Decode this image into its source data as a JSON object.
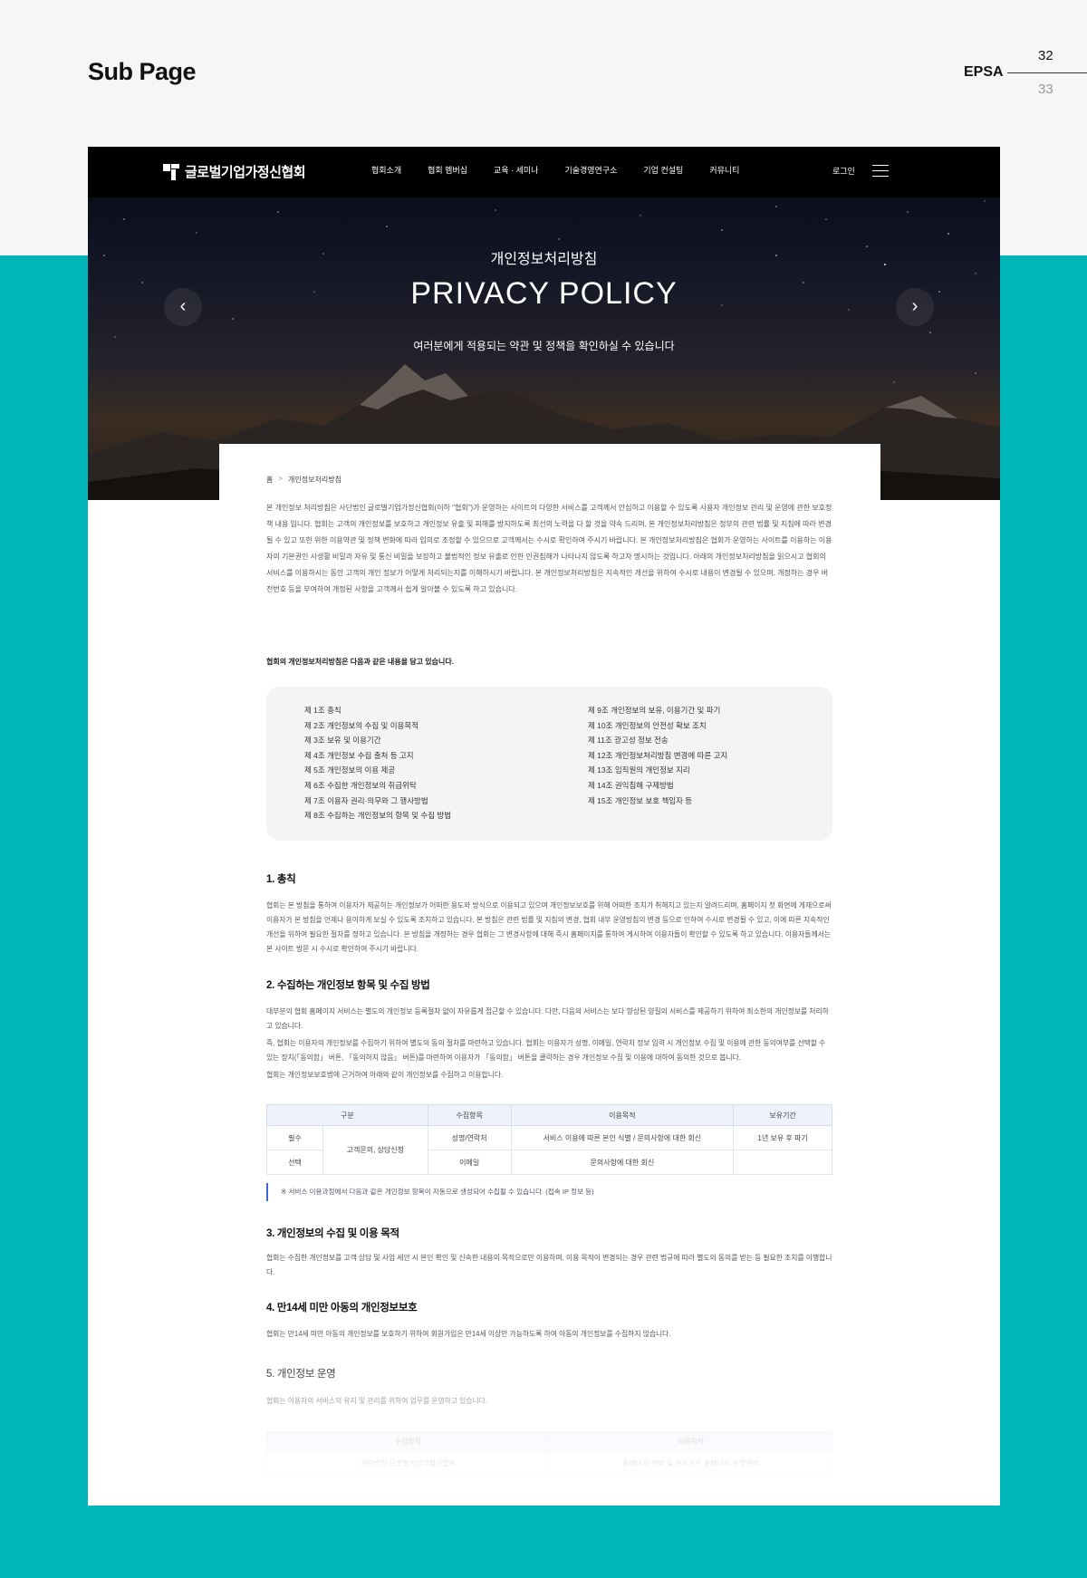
{
  "presentation": {
    "title": "Sub Page",
    "brand": "EPSA",
    "page_current": "32",
    "page_next": "33",
    "colors": {
      "band": "#00b5b8",
      "background": "#f6f6f6",
      "accent": "#3a64d8"
    }
  },
  "header": {
    "logo_text": "글로벌기업가정신협회",
    "nav": [
      "협회소개",
      "협회 멤버십",
      "교육 · 세미나",
      "기술경영연구소",
      "기업 컨설팅",
      "커뮤니티"
    ],
    "login": "로그인",
    "menu_icon": "hamburger-icon"
  },
  "hero": {
    "subtitle": "개인정보처리방침",
    "title": "PRIVACY POLICY",
    "description": "여러분에게 적용되는 약관 및 정책을 확인하실 수 있습니다",
    "prev_icon": "chevron-left-icon",
    "next_icon": "chevron-right-icon"
  },
  "breadcrumb": {
    "home": "홈",
    "separator": ">",
    "current": "개인정보처리방침"
  },
  "intro": "본 개인정보 처리방침은 사단법인 글로벌기업가정신협회(이하 \"협회\")가 운영하는 사이트의 다양한 서비스를 고객께서 안심하고 이용할 수 있도록 사용자 개인정보 관리 및 운영에 관한 보호정책 내용 입니다. 협회는 고객의 개인정보를 보호하고 개인정보 유출 및 피해를 방지하도록 최선의 노력을 다 할 것을 약속 드리며, 본 개인정보처리방침은 정부의 관련 법률 및 지침에 따라 변경될 수 있고 또한 위한 이용약관 및 정책 변화에 따라 임의로 조정할 수 있으므로 고객께서는 수시로 확인하여 주시기 바랍니다. 본 개인정보처리방침은 협회가 운영하는 사이트를 이용하는 이용자의 기본권인 사생활 비밀과 자유 및 통신 비밀을 보장하고 불법적인 정보 유출로 인한 인권침해가 나타나지 않도록 하고자 명시하는 것입니다. 아래의 개인정보처리방침을 읽으시고 협회의 서비스를 이용하시는 동안 고객의 개인 정보가 어떻게 처리되는지를 이해하시기 바랍니다. 본 개인정보처리방침은 지속적인 개선을 위하여 수시로 내용이 변경될 수 있으며, 개정하는 경우 버전번호 등을 부여하여 개정된 사항을 고객께서 쉽게 알아볼 수 있도록 하고 있습니다.",
  "lead": "협회의 개인정보처리방침은 다음과 같은 내용을 담고 있습니다.",
  "toc": {
    "left": [
      "제 1조 총칙",
      "제 2조 개인정보의 수집 및 이용목적",
      "제 3조 보유 및 이용기간",
      "제 4조 개인정보 수집 출처 등 고지",
      "제 5조 개인정보의 이용 제공",
      "제 6조 수집한 개인정보의 취급위탁",
      "제 7조 이용자 권리·의무와 그 행사방법",
      "제 8조 수집하는 개인정보의 항목 및 수집 방법"
    ],
    "right": [
      "제 9조 개인정보의 보유, 이용기간 및 파기",
      "제 10조 개인정보의 안전성 확보 조치",
      "제 11조 광고성 정보 전송",
      "제 12조 개인정보처리방침 변경에 따른 고지",
      "제 13조 임직원의 개인정보 지리",
      "제 14조 권익침해 구제방법",
      "제 15조 개인정보 보호 책임자 등"
    ]
  },
  "sections": {
    "s1": {
      "title": "1. 총칙",
      "body": "협회는 본 방침을 통하여 이용자가 제공하는 개인정보가 어떠한 용도와 방식으로 이용되고 있으며 개인정보보호를 위해 어떠한 조치가 취해지고 있는지 알려드리며, 홈페이지 첫 화면에 게재으로써 이용자가 본 방침을 언제나 용이하게 보실 수 있도록 조치하고 있습니다. 본 방침은 관련 법률 및 지침의 변경, 협회 내부 운영방침의 변경 등으로 인하여 수시로 변경될 수 있고, 이에 따른 지속적인 개선을 위하여 필요한 절차를 정하고 있습니다. 본 방침을 개정하는 경우 협회는 그 변경사항에 대해 즉시 홈페이지를 통하여 게시하여 이용자들이 확인할 수 있도록 하고 있습니다. 이용자들께서는 본 사이트 방문 시 수시로 확인하여 주시기 바랍니다."
    },
    "s2": {
      "title": "2. 수집하는 개인정보 항목 및 수집 방법",
      "body1": "대부분의 협회 홈페이지 서비스는 별도의 개인정보 등록절차 없이 자유롭게 접근할 수 있습니다. 다만, 다음의 서비스는 보다 향상된 양질의 서비스를 제공하기 위하여 최소한의 개인정보를 처리하고 있습니다.",
      "body2": "즉, 협회는 이용자의 개인정보를 수집하기 위하여 별도의 동의 절차를 마련하고 있습니다. 협회는 이용자가 성명, 이메일, 연락처 정보 입력 시 개인정보 수집 및 이용에 관한 동의여부를 선택할 수 있는 장치(「동의함」 버튼, 「동의하지 않음」 버튼)를 마련하여 이용자가 「동의함」 버튼을 클릭하는 경우 개인정보 수집 및 이용에 대하여 동의한 것으로 봅니다.",
      "body3": "협회는 개인정보보호법에 근거하여 아래와 같이 개인정보를 수집하고 이용합니다.",
      "table": {
        "headers": [
          "구분",
          "수집항목",
          "이용목적",
          "보유기간"
        ],
        "rows": [
          {
            "type": "필수",
            "category": "고객문의, 상담신청",
            "items": "성명/연락처",
            "purpose": "서비스 이용에 따른 본인 식별 / 문의사항에 대한 회신",
            "period": "1년 보유 후 파기"
          },
          {
            "type": "선택",
            "items": "이메일",
            "purpose": "문의사항에 대한 회신",
            "period": ""
          }
        ]
      },
      "note": "※ 서비스 이용과정에서 다음과 같은 개인정보 항목이 자동으로 생성되어 수집될 수 있습니다. (접속 IP 정보 등)"
    },
    "s3": {
      "title": "3. 개인정보의 수집 및 이용 목적",
      "body": "협회는 수집한 개인정보를 고객 상담 및 사업 세안 시 본인 확인 및 신속한 내용의 목적으로만 이용하며, 이용 목적이 변경되는 경우 관련 법규에 따라 별도의 동의를 받는 등 필요한 조치를 이행합니다."
    },
    "s4": {
      "title": "4. 만14세 미만 아동의 개인정보보호",
      "body": "협회는 만14세 미만 아동의 개인정보를 보호하기 위하여 회원가입은 만14세 이상만 가능하도록 하여 아동의 개인정보를 수집하지 않습니다."
    },
    "s5": {
      "title": "5. 개인정보 운영",
      "body": "협회는 이용자의 서비스의 유지 및 관리를 위하여 업무를 운영하고 있습니다.",
      "table": {
        "headers": [
          "수집항목",
          "이용목적"
        ],
        "rows": [
          {
            "items": "사단법인 글로벌기업가정신협회",
            "purpose": "홈페이지 관리 및 유지보수 홈페이지 운영관리"
          }
        ]
      }
    }
  }
}
